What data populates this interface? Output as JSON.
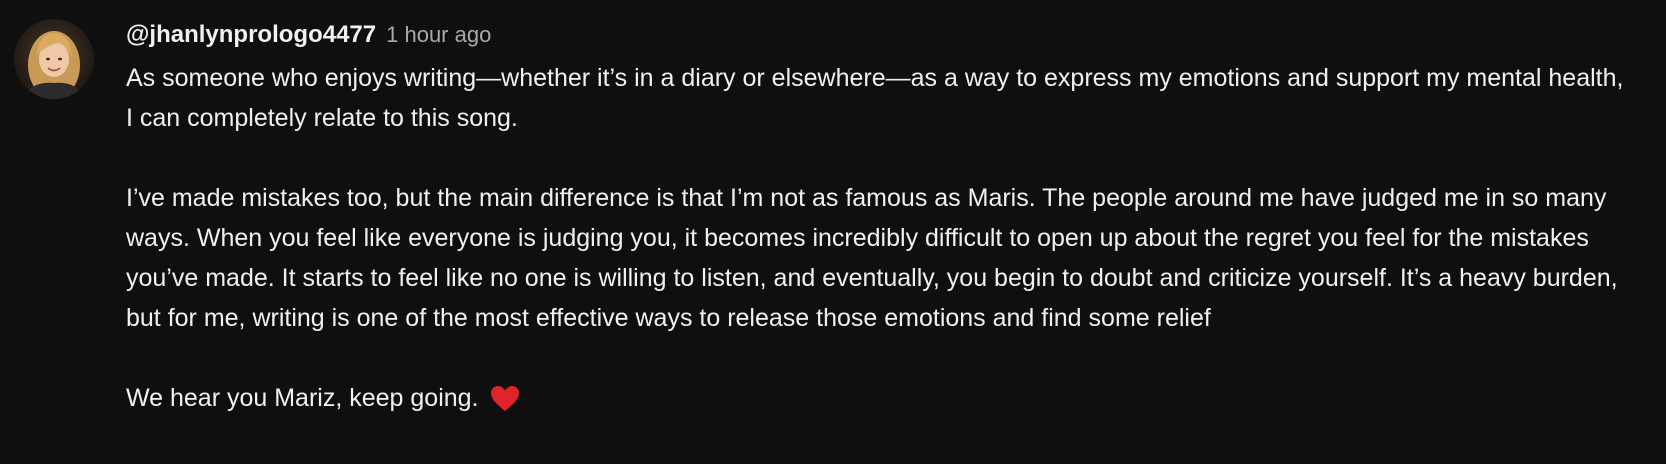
{
  "comment": {
    "author": "@jhanlynprologo4477",
    "timestamp": "1 hour ago",
    "avatar_icon": "avatar-photo",
    "paragraphs": [
      "As someone who enjoys writing—whether it’s in a diary or elsewhere—as a way to express my emotions and support my mental health, I can completely relate to this song.",
      "I’ve made mistakes too, but the main difference is that I’m not as famous as Maris. The people around me have judged me in so many ways. When you feel like everyone is judging you, it becomes incredibly difficult to open up about the regret you feel for the mistakes you’ve made. It starts to feel like no one is willing to listen, and eventually, you begin to doubt and criticize yourself. It’s a heavy burden, but for me, writing is one of the most effective ways to release those emotions and find some relief",
      "We hear you Mariz, keep going."
    ],
    "trailing_icon": "red-heart-icon"
  },
  "colors": {
    "background": "#0f0f0f",
    "text": "#f1f1f1",
    "secondary_text": "#aaaaaa",
    "heart": "#e0242b"
  }
}
